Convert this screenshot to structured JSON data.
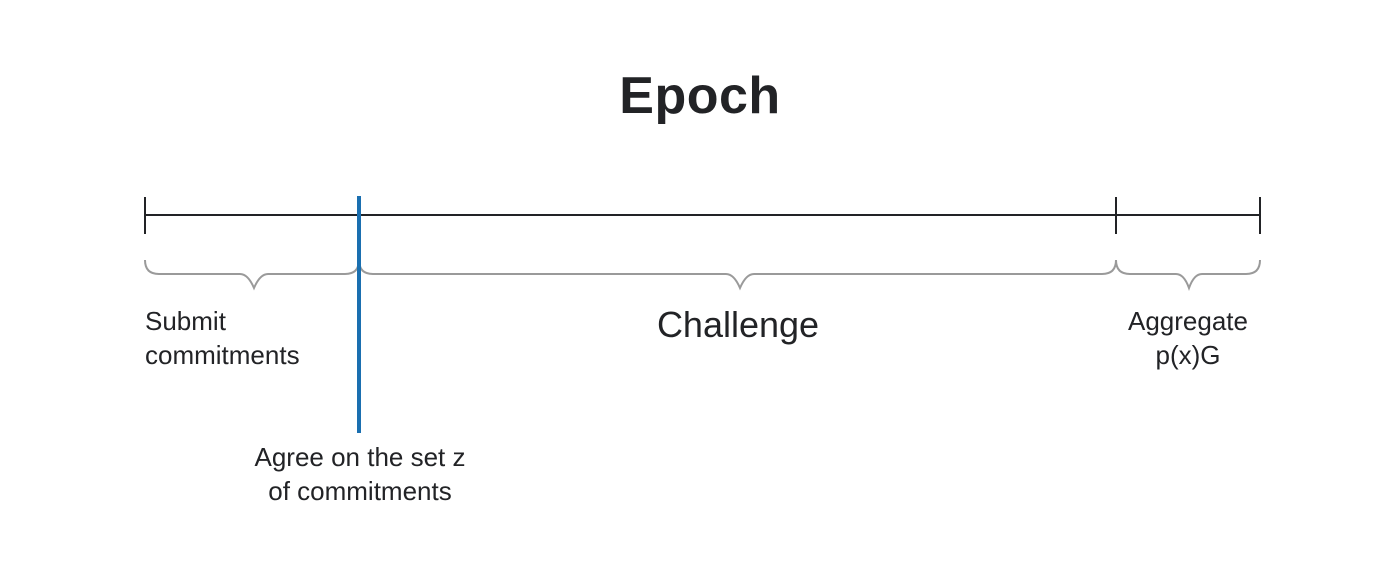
{
  "diagram": {
    "title": "Epoch",
    "phases": {
      "submit": [
        "Submit",
        "commitments"
      ],
      "challenge": "Challenge",
      "aggregate": [
        "Aggregate",
        "p(x)G"
      ]
    },
    "marker": {
      "label": [
        "Agree on the set z",
        "of commitments"
      ]
    },
    "colors": {
      "axis": "#222326",
      "brace": "#9a9a9a",
      "marker": "#1a6fb0",
      "text": "#222326"
    }
  }
}
